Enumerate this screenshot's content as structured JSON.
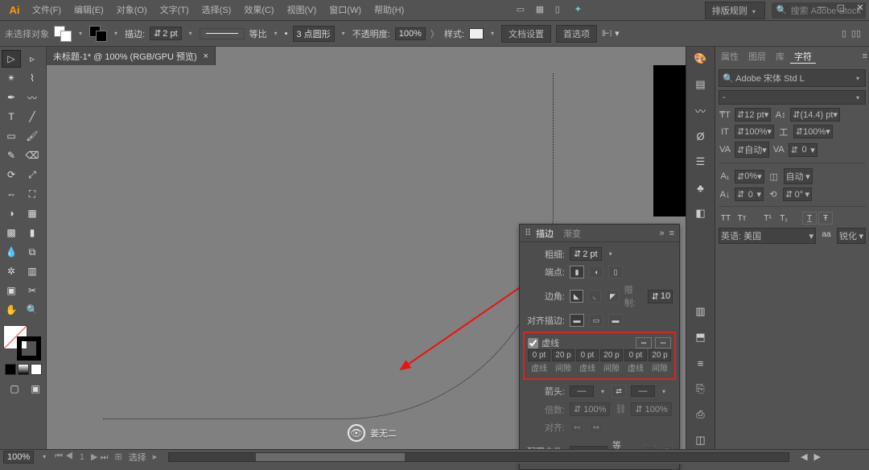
{
  "menu": {
    "items": [
      "文件(F)",
      "编辑(E)",
      "对象(O)",
      "文字(T)",
      "选择(S)",
      "效果(C)",
      "视图(V)",
      "窗口(W)",
      "帮助(H)"
    ],
    "layout_rule": "排版规则",
    "stock_placeholder": "搜索 Adobe Stock"
  },
  "toolbar": {
    "status": "未选择对象",
    "stroke_label": "描边:",
    "stroke_weight": "2 pt",
    "uniform_label": "等比",
    "dash_preset": "3 点圆形",
    "opacity_label": "不透明度:",
    "opacity_value": "100%",
    "style_label": "样式:",
    "doc_setup": "文档设置",
    "preferences": "首选项"
  },
  "tab": {
    "label": "未标题-1* @ 100% (RGB/GPU 预览)"
  },
  "char_panel": {
    "tabs": [
      "属性",
      "图层",
      "库",
      "字符"
    ],
    "active_tab": 3,
    "font": "Adobe 宋体 Std L",
    "style": "-",
    "size": "12 pt",
    "leading": "(14.4) pt",
    "hscale": "100%",
    "vscale": "100%",
    "kerning": "自动",
    "tracking": "0",
    "baseline": "0%",
    "alt": "自动",
    "rotate": "0°",
    "lang": "英语: 美国",
    "aa_label": "锐化",
    "aa_prefix": "aa"
  },
  "stroke_panel": {
    "tabs": [
      "描边",
      "渐变"
    ],
    "active": 0,
    "weight_label": "粗细:",
    "weight": "2 pt",
    "cap_label": "端点:",
    "corner_label": "边角:",
    "miter_limit": "10",
    "align_label": "对齐描边:",
    "dashed_label": "虚线",
    "dashed_on": true,
    "dash_values": [
      "0 pt",
      "20 p",
      "0 pt",
      "20 p",
      "0 pt",
      "20 p"
    ],
    "dash_labels": [
      "虚线",
      "间隙",
      "虚线",
      "间隙",
      "虚线",
      "间隙"
    ],
    "arrow_label": "箭头:",
    "scale_label": "倍数:",
    "align_arrow_label": "对齐:",
    "profile_label": "配置文件:",
    "profile_value": "等比"
  },
  "statusbar": {
    "zoom": "100%",
    "sel_label": "选择"
  },
  "watermark": "姜无二"
}
